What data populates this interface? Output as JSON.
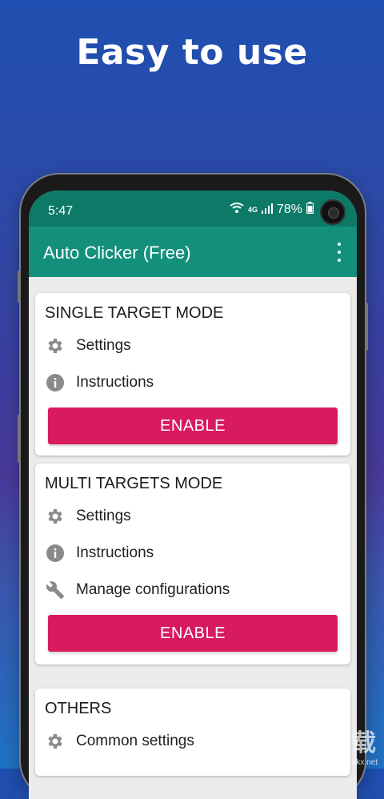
{
  "headline": "Easy to use",
  "status_bar": {
    "time": "5:47",
    "network": "4G",
    "battery": "78%"
  },
  "app_bar": {
    "title": "Auto Clicker (Free)"
  },
  "cards": [
    {
      "title": "SINGLE TARGET MODE",
      "items": [
        {
          "icon": "gear-icon",
          "label": "Settings"
        },
        {
          "icon": "info-icon",
          "label": "Instructions"
        }
      ],
      "button": "ENABLE"
    },
    {
      "title": "MULTI TARGETS MODE",
      "items": [
        {
          "icon": "gear-icon",
          "label": "Settings"
        },
        {
          "icon": "info-icon",
          "label": "Instructions"
        },
        {
          "icon": "wrench-icon",
          "label": "Manage configurations"
        }
      ],
      "button": "ENABLE"
    },
    {
      "title": "OTHERS",
      "items": [
        {
          "icon": "gear-icon",
          "label": "Common settings"
        }
      ]
    }
  ],
  "watermark": {
    "logo_text": "KKX下载",
    "url": "www.kkx.net"
  },
  "colors": {
    "status_bar": "#0c7a67",
    "app_bar": "#12907a",
    "enable_button": "#d81b5f",
    "icon": "#8a8a8a"
  }
}
